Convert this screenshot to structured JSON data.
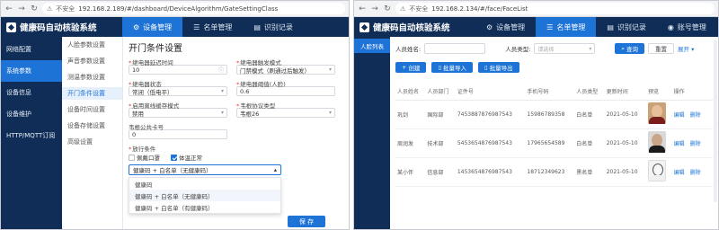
{
  "left": {
    "browser": {
      "security": "不安全",
      "url": "192.168.2.189/#/dashboard/DeviceAlgorithm/GateSettingClass"
    },
    "header": {
      "logo": "健康码自动核验系统",
      "nav": [
        "设备管理",
        "名单管理",
        "识别记录"
      ]
    },
    "sidebar": [
      "网络配置",
      "系统参数",
      "设备信息",
      "设备维护",
      "HTTP/MQTT订阅"
    ],
    "subnav": [
      "人脸参数设置",
      "声音参数设置",
      "测温参数设置",
      "开门条件设置",
      "设备时间设置",
      "设备存储设置",
      "高级设置"
    ],
    "form": {
      "title": "开门条件设置",
      "relay_delay_label": "继电器延迟时间",
      "relay_delay_value": "10",
      "relay_mode_label": "继电器触发模式",
      "relay_mode_value": "门禁模式（刷通过后触发）",
      "relay_state_label": "继电器状态",
      "relay_state_value": "常闭（低电平）",
      "relay_threshold_label": "继电器阈值(人脸)",
      "relay_threshold_value": "0.6",
      "cache_label": "启用离线缓存模式",
      "cache_value": "禁用",
      "wiegand_label": "韦根协议类型",
      "wiegand_value": "韦根26",
      "card_label": "韦根公共卡号",
      "card_value": "0",
      "condition_label": "放行条件",
      "cond_mask": "佩戴口罩",
      "cond_temp": "体温正常",
      "select_value": "健康码 + 白名单（无健康码）",
      "dropdown": [
        "健康码",
        "健康码 + 白名单（无健康码）",
        "健康码 + 白名单（有健康码）"
      ],
      "save": "保 存"
    }
  },
  "right": {
    "browser": {
      "security": "不安全",
      "url": "192.168.2.134/#/face/FaceList"
    },
    "header": {
      "logo": "健康码自动核验系统",
      "nav": [
        "设备管理",
        "名单管理",
        "识别记录",
        "账号管理"
      ]
    },
    "sidebar": [
      "人脸列表"
    ],
    "search": {
      "name_label": "人员姓名:",
      "type_label": "人员类型:",
      "type_placeholder": "请选择",
      "search_btn": "查询",
      "reset_btn": "重置",
      "expand": "展开"
    },
    "actions": [
      "创建",
      "批量导入",
      "批量导出"
    ],
    "table": {
      "headers": [
        "人员姓名",
        "人员部门",
        "证件号",
        "手机号码",
        "人员类型",
        "更新时间",
        "预览",
        "操作"
      ],
      "rows": [
        {
          "name": "巩剑",
          "dept": "国际部",
          "id": "7453887876987543",
          "phone": "15986789358",
          "type": "白名单",
          "date": "2021-05-10",
          "edit": "编辑",
          "del": "删除"
        },
        {
          "name": "周润发",
          "dept": "技术部",
          "id": "5453654876987543",
          "phone": "17965654589",
          "type": "白名单",
          "date": "2021-05-10",
          "edit": "编辑",
          "del": "删除"
        },
        {
          "name": "某小伴",
          "dept": "信息部",
          "id": "1453654876987543",
          "phone": "18712349623",
          "type": "黑名单",
          "date": "2021-05-10",
          "edit": "编辑",
          "del": "删除"
        }
      ]
    }
  },
  "colors": {
    "header_bg": "#0f2d57",
    "accent": "#1d73d6"
  }
}
